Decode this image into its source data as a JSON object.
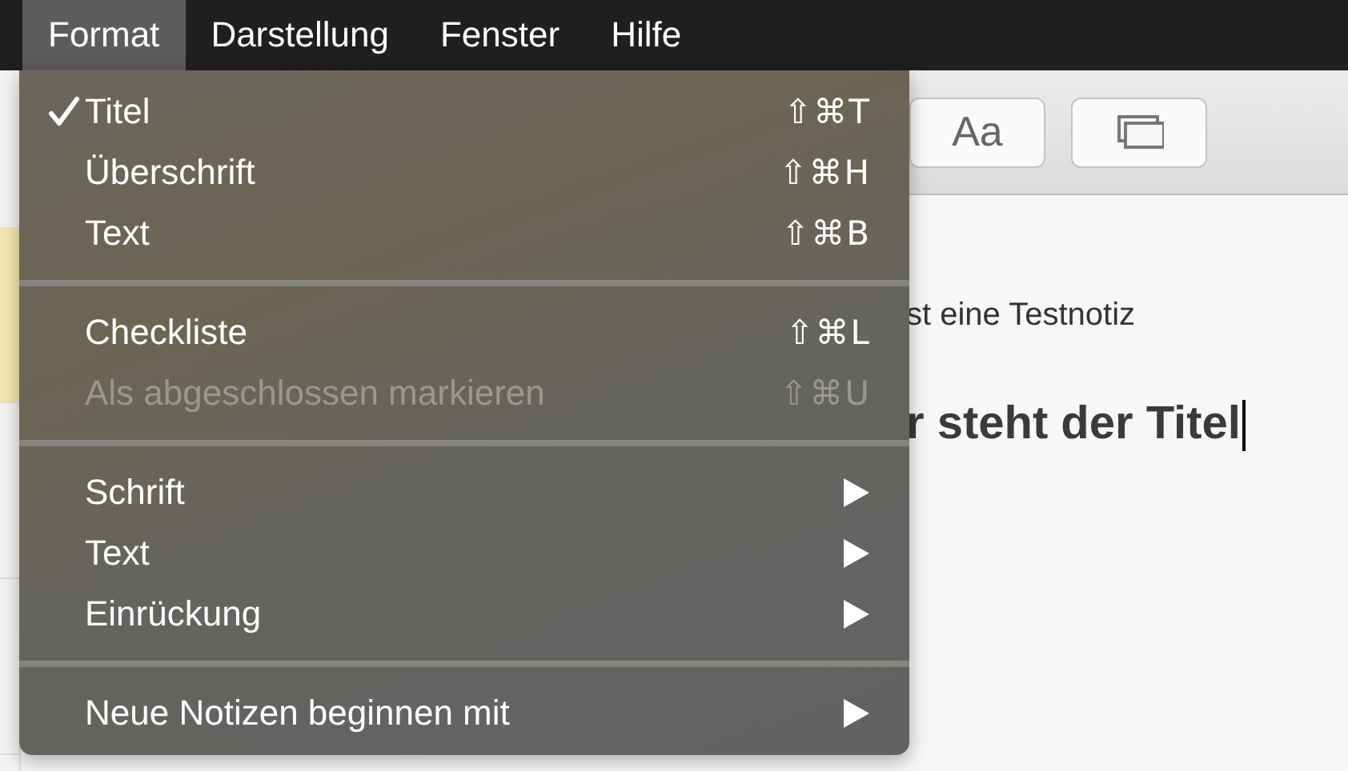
{
  "menubar": [
    {
      "label": "Format",
      "selected": true
    },
    {
      "label": "Darstellung",
      "selected": false
    },
    {
      "label": "Fenster",
      "selected": false
    },
    {
      "label": "Hilfe",
      "selected": false
    }
  ],
  "sidebar": {
    "notes": [
      {
        "selected": true
      },
      {
        "selected": false
      },
      {
        "selected": false
      }
    ]
  },
  "toolbar": {
    "font_button": "Aa"
  },
  "note": {
    "line": "st eine Testnotiz",
    "title": "r steht der Titel"
  },
  "menu": {
    "sections": [
      [
        {
          "kind": "command",
          "label": "Titel",
          "shortcut": "⇧⌘T",
          "checked": true,
          "disabled": false
        },
        {
          "kind": "command",
          "label": "Überschrift",
          "shortcut": "⇧⌘H",
          "checked": false,
          "disabled": false
        },
        {
          "kind": "command",
          "label": "Text",
          "shortcut": "⇧⌘B",
          "checked": false,
          "disabled": false
        }
      ],
      [
        {
          "kind": "command",
          "label": "Checkliste",
          "shortcut": "⇧⌘L",
          "checked": false,
          "disabled": false
        },
        {
          "kind": "command",
          "label": "Als abgeschlossen markieren",
          "shortcut": "⇧⌘U",
          "checked": false,
          "disabled": true
        }
      ],
      [
        {
          "kind": "submenu",
          "label": "Schrift"
        },
        {
          "kind": "submenu",
          "label": "Text"
        },
        {
          "kind": "submenu",
          "label": "Einrückung"
        }
      ],
      [
        {
          "kind": "submenu",
          "label": "Neue Notizen beginnen mit"
        }
      ]
    ]
  }
}
